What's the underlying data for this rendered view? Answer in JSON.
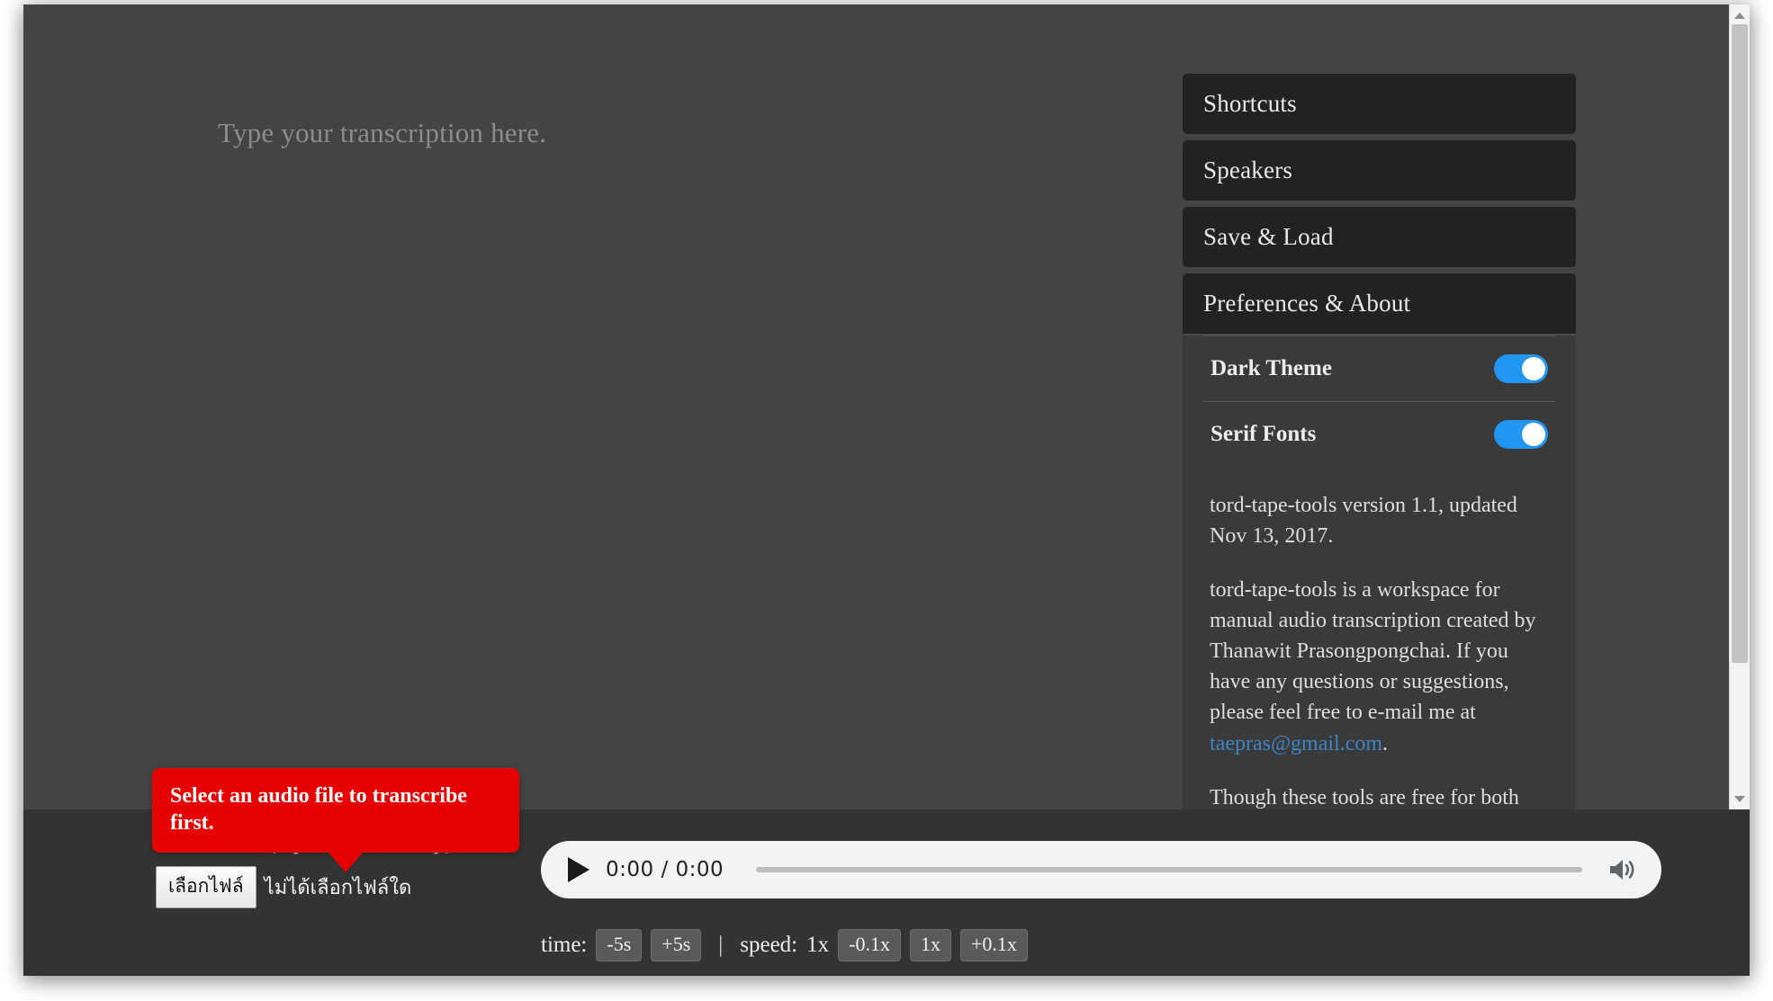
{
  "editor": {
    "placeholder": "Type your transcription here.",
    "value": ""
  },
  "panel": {
    "sections": [
      {
        "label": "Shortcuts",
        "open": false
      },
      {
        "label": "Speakers",
        "open": false
      },
      {
        "label": "Save & Load",
        "open": false
      },
      {
        "label": "Preferences & About",
        "open": true
      }
    ],
    "preferences": [
      {
        "label": "Dark Theme",
        "enabled": true
      },
      {
        "label": "Serif Fonts",
        "enabled": true
      }
    ],
    "about": {
      "version_line": "tord-tape-tools version 1.1, updated Nov 13, 2017.",
      "paragraph2_before_link": "tord-tape-tools is a workspace for manual audio transcription created by Thanawit Prasongpongchai. If you have any questions or suggestions, please feel free to e-mail me at ",
      "email": "taepras@gmail.com",
      "paragraph2_after_link": ".",
      "paragraph3": "Though these tools are free for both personal and commercial use, there is some cost in maintaining this site. If you want to help, I would really appreciate if"
    }
  },
  "tooltip": {
    "message": "Select an audio file to transcribe first."
  },
  "loader": {
    "label": "Load Audio (mp3/ogg/wav only):",
    "button_label": "เลือกไฟล์",
    "status": "ไม่ได้เลือกไฟล์ใด"
  },
  "player": {
    "time_display": "0:00 / 0:00",
    "play_icon": "play-icon",
    "volume_icon": "volume-icon",
    "progress_percent": 0
  },
  "controls": {
    "time_label": "time:",
    "time_buttons": [
      "-5s",
      "+5s"
    ],
    "separator": "|",
    "speed_label": "speed:",
    "speed_value": "1x",
    "speed_buttons": [
      "-0.1x",
      "1x",
      "+0.1x"
    ]
  },
  "colors": {
    "app_background": "#444444",
    "bottom_bar": "#333333",
    "accordion_header": "#222222",
    "accordion_body": "#3a3a3a",
    "toggle_on": "#2196f3",
    "tooltip_red": "#e60000",
    "link_blue": "#3d85c6"
  }
}
